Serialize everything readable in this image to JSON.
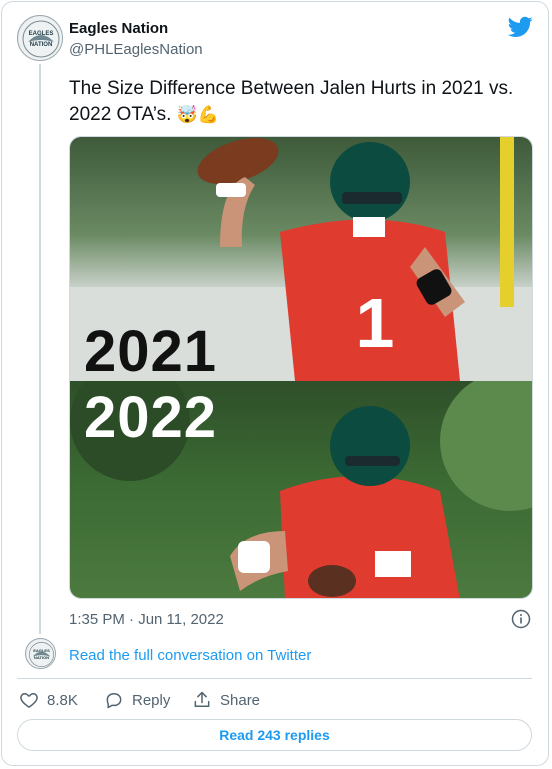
{
  "user": {
    "name": "Eagles Nation",
    "handle": "@PHLEaglesNation",
    "avatar_text_line1": "EAGLES",
    "avatar_text_line2": "NATION"
  },
  "tweet": {
    "text": "The Size Difference Between Jalen Hurts in 2021 vs. 2022 OTA’s.",
    "emojis": "🤯💪",
    "timestamp": "1:35 PM · Jun 11, 2022"
  },
  "media": {
    "label_top": "2021",
    "label_bottom": "2022"
  },
  "conversation": {
    "read_full_label": "Read the full conversation on Twitter"
  },
  "actions": {
    "like_count": "8.8K",
    "reply_label": "Reply",
    "share_label": "Share"
  },
  "replies": {
    "read_label": "Read 243 replies"
  },
  "colors": {
    "accent": "#1d9bf0",
    "secondary_text": "#536471",
    "border": "#cfd9de",
    "jersey": "#e03b2f",
    "helmet": "#0b4b40"
  },
  "icons": {
    "brand": "twitter-bird-icon",
    "info": "info-icon",
    "like": "heart-icon",
    "reply": "speech-bubble-icon",
    "share": "share-icon"
  }
}
